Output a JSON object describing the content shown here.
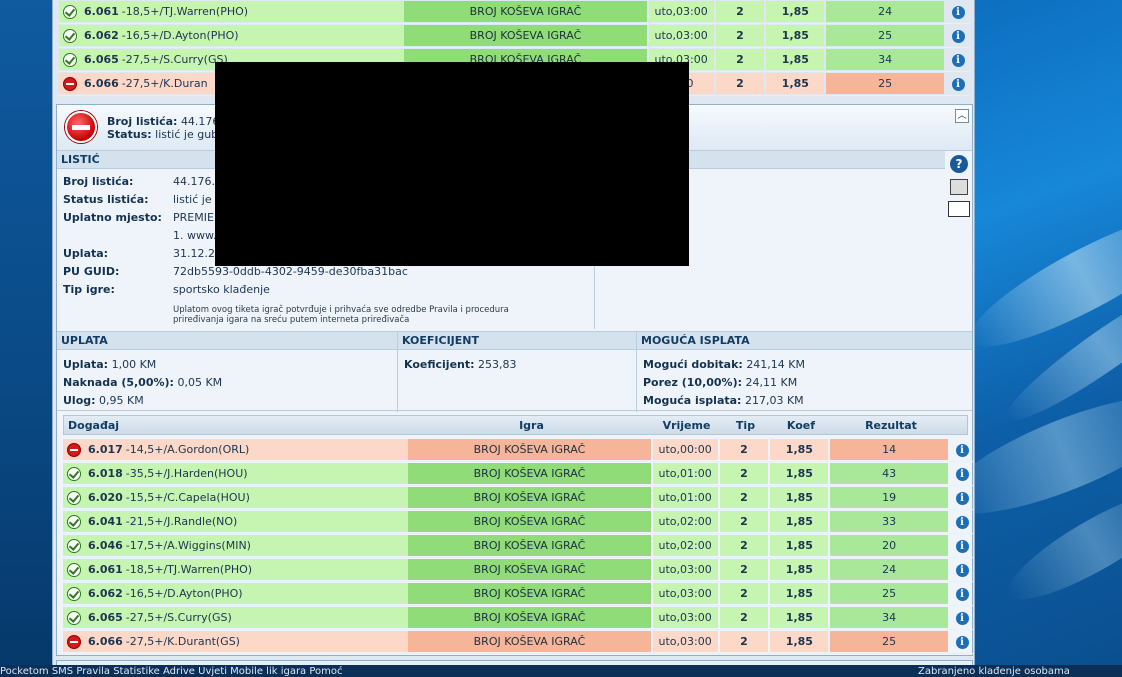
{
  "top_rows": [
    {
      "status": "win",
      "code": "6.061",
      "desc": "-18,5+/TJ.Warren(PHO)",
      "game": "BROJ KOŠEVA IGRAČ",
      "time": "uto,03:00",
      "tip": "2",
      "koef": "1,85",
      "result": "24"
    },
    {
      "status": "win",
      "code": "6.062",
      "desc": "-16,5+/D.Ayton(PHO)",
      "game": "BROJ KOŠEVA IGRAČ",
      "time": "uto,03:00",
      "tip": "2",
      "koef": "1,85",
      "result": "25"
    },
    {
      "status": "win",
      "code": "6.065",
      "desc": "-27,5+/S.Curry(GS)",
      "game": "BROJ KOŠEVA IGRAČ",
      "time": "uto,03:00",
      "tip": "2",
      "koef": "1,85",
      "result": "34"
    },
    {
      "status": "lose",
      "code": "6.066",
      "desc": "-27,5+/K.Duran",
      "game": "",
      "time": "3:00",
      "tip": "2",
      "koef": "1,85",
      "result": "25"
    }
  ],
  "ticket_header": {
    "number_label": "Broj listića:",
    "number_value": "44.176",
    "status_label": "Status:",
    "status_value": "listić je gub"
  },
  "listic": {
    "title": "LISTIĆ",
    "fields": [
      {
        "key": "Broj listića:",
        "value": "44.176.."
      },
      {
        "key": "Status listića:",
        "value": "listić je"
      },
      {
        "key": "Uplatno mjesto:",
        "value": "PREMIEI"
      },
      {
        "key": "",
        "value": "1. www."
      },
      {
        "key": "Uplata:",
        "value": "31.12.2"
      },
      {
        "key": "PU GUID:",
        "value": "72db5593-0ddb-4302-9459-de30fba31bac"
      },
      {
        "key": "Tip igre:",
        "value": "sportsko klađenje"
      }
    ],
    "note_line1": "Uplatom ovog tiketa igrač potvrđuje i prihvaća sve odredbe Pravila i procedura",
    "note_line2": "priređivanja igara na sreću putem interneta priređivača"
  },
  "uplata": {
    "title": "UPLATA",
    "lines": [
      {
        "k": "Uplata:",
        "v": "1,00 KM"
      },
      {
        "k": "Naknada (5,00%):",
        "v": "0,05 KM"
      },
      {
        "k": "Ulog:",
        "v": "0,95 KM"
      }
    ]
  },
  "koeficijent": {
    "title": "KOEFICIJENT",
    "k": "Koeficijent:",
    "v": "253,83"
  },
  "moguca": {
    "title": "MOGUĆA ISPLATA",
    "lines": [
      {
        "k": "Mogući dobitak:",
        "v": "241,14 KM"
      },
      {
        "k": "Porez (10,00%):",
        "v": "24,11 KM"
      },
      {
        "k": "Moguća isplata:",
        "v": "217,03 KM"
      }
    ]
  },
  "table_head": {
    "event": "Događaj",
    "game": "Igra",
    "time": "Vrijeme",
    "tip": "Tip",
    "koef": "Koef",
    "result": "Rezultat"
  },
  "rows": [
    {
      "status": "lose",
      "code": "6.017",
      "desc": "-14,5+/A.Gordon(ORL)",
      "game": "BROJ KOŠEVA IGRAČ",
      "time": "uto,00:00",
      "tip": "2",
      "koef": "1,85",
      "result": "14"
    },
    {
      "status": "win",
      "code": "6.018",
      "desc": "-35,5+/J.Harden(HOU)",
      "game": "BROJ KOŠEVA IGRAČ",
      "time": "uto,01:00",
      "tip": "2",
      "koef": "1,85",
      "result": "43"
    },
    {
      "status": "win",
      "code": "6.020",
      "desc": "-15,5+/C.Capela(HOU)",
      "game": "BROJ KOŠEVA IGRAČ",
      "time": "uto,01:00",
      "tip": "2",
      "koef": "1,85",
      "result": "19"
    },
    {
      "status": "win",
      "code": "6.041",
      "desc": "-21,5+/J.Randle(NO)",
      "game": "BROJ KOŠEVA IGRAČ",
      "time": "uto,02:00",
      "tip": "2",
      "koef": "1,85",
      "result": "33"
    },
    {
      "status": "win",
      "code": "6.046",
      "desc": "-17,5+/A.Wiggins(MIN)",
      "game": "BROJ KOŠEVA IGRAČ",
      "time": "uto,02:00",
      "tip": "2",
      "koef": "1,85",
      "result": "20"
    },
    {
      "status": "win",
      "code": "6.061",
      "desc": "-18,5+/TJ.Warren(PHO)",
      "game": "BROJ KOŠEVA IGRAČ",
      "time": "uto,03:00",
      "tip": "2",
      "koef": "1,85",
      "result": "24"
    },
    {
      "status": "win",
      "code": "6.062",
      "desc": "-16,5+/D.Ayton(PHO)",
      "game": "BROJ KOŠEVA IGRAČ",
      "time": "uto,03:00",
      "tip": "2",
      "koef": "1,85",
      "result": "25"
    },
    {
      "status": "win",
      "code": "6.065",
      "desc": "-27,5+/S.Curry(GS)",
      "game": "BROJ KOŠEVA IGRAČ",
      "time": "uto,03:00",
      "tip": "2",
      "koef": "1,85",
      "result": "34"
    },
    {
      "status": "lose",
      "code": "6.066",
      "desc": "-27,5+/K.Durant(GS)",
      "game": "BROJ KOŠEVA IGRAČ",
      "time": "uto,03:00",
      "tip": "2",
      "koef": "1,85",
      "result": "25"
    }
  ],
  "taskbar": {
    "left": "Pocketom   SMS   Pravila   Statistike   Adrive  Uvjeti   Mobile   lik igara   Pomoć",
    "right": "Zabranjeno klađenje osobama"
  }
}
